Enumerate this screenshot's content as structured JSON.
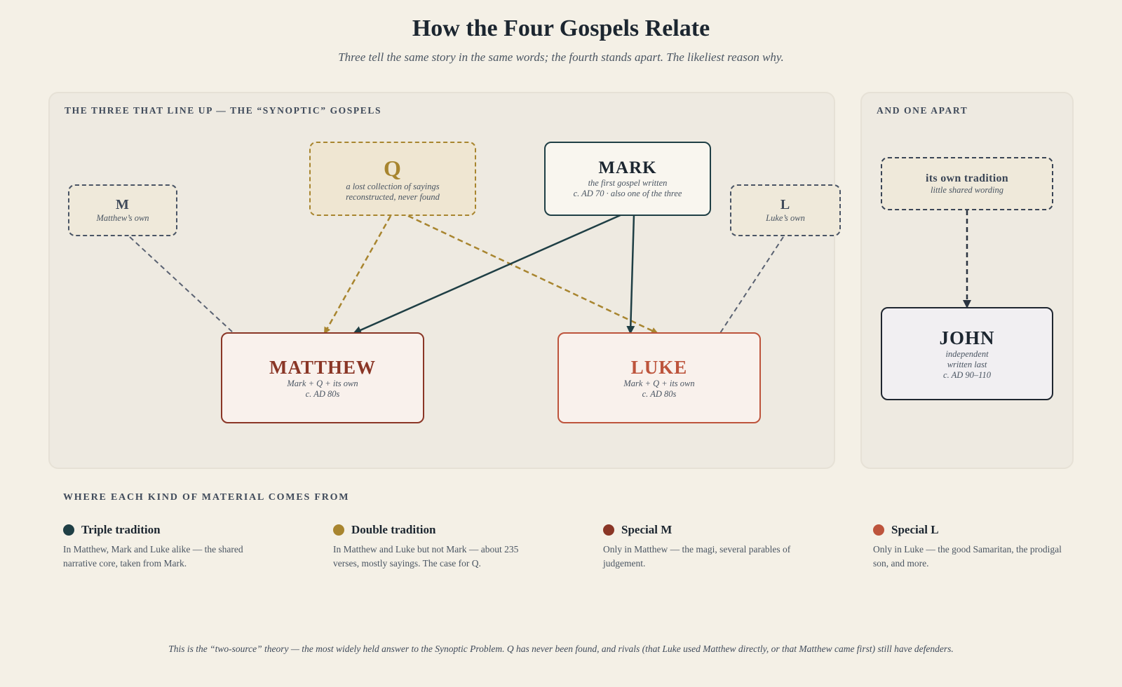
{
  "header": {
    "title": "How the Four Gospels Relate",
    "subtitle": "Three tell the same story in the same words; the fourth stands apart. The likeliest reason why."
  },
  "panels": {
    "synoptic_label": "The three that line up — the “synoptic” gospels",
    "apart_label": "And one apart"
  },
  "nodes": {
    "m": {
      "name": "M",
      "note": "Matthew’s own"
    },
    "q": {
      "name": "Q",
      "note1": "a lost collection of sayings",
      "note2": "reconstructed, never found"
    },
    "mark": {
      "name": "MARK",
      "note1": "the first gospel written",
      "note2": "c. AD 70 · also one of the three"
    },
    "l": {
      "name": "L",
      "note": "Luke’s own"
    },
    "matthew": {
      "name": "MATTHEW",
      "note1": "Mark + Q + its own",
      "note2": "c. AD 80s"
    },
    "luke": {
      "name": "LUKE",
      "note1": "Mark + Q + its own",
      "note2": "c. AD 80s"
    },
    "own_tradition": {
      "name": "its own tradition",
      "note": "little shared wording"
    },
    "john": {
      "name": "JOHN",
      "note1": "independent",
      "note2": "written last",
      "note3": "c. AD 90–110"
    }
  },
  "legend": {
    "heading": "WHERE EACH KIND OF MATERIAL COMES FROM",
    "items": [
      {
        "title": "Triple tradition",
        "color": "#1f3f45",
        "desc": "In Matthew, Mark and Luke alike — the shared narrative core, taken from Mark."
      },
      {
        "title": "Double tradition",
        "color": "#a8852f",
        "desc": "In Matthew and Luke but not Mark — about 235 verses, mostly sayings. The case for Q."
      },
      {
        "title": "Special M",
        "color": "#8a3626",
        "desc": "Only in Matthew — the magi, several parables of judgement."
      },
      {
        "title": "Special L",
        "color": "#bd543c",
        "desc": "Only in Luke — the good Samaritan, the prodigal son, and more."
      }
    ]
  },
  "footnote": "This is the “two-source” theory — the most widely held answer to the Synoptic Problem. Q has never been found, and rivals (that Luke used Matthew directly, or that Matthew came first) still have defenders.",
  "colors": {
    "mark": "#1f3f45",
    "q": "#a8852f",
    "matthew": "#8a3626",
    "luke": "#bd543c",
    "special": "#5a6272"
  }
}
